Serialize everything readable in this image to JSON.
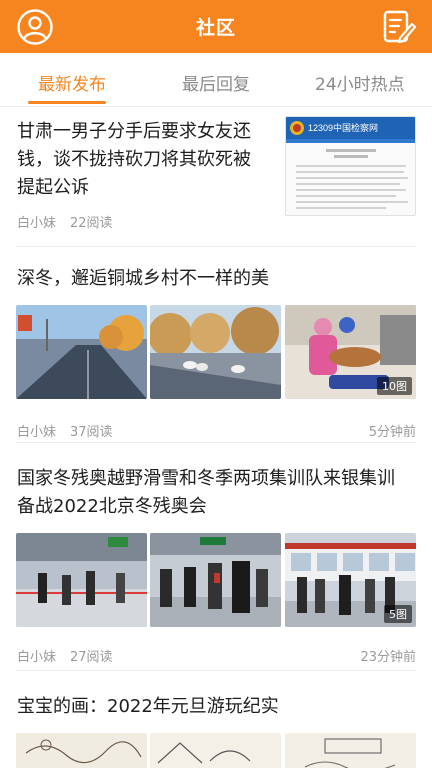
{
  "header": {
    "title": "社区"
  },
  "tabs": [
    {
      "label": "最新发布",
      "active": true
    },
    {
      "label": "最后回复",
      "active": false
    },
    {
      "label": "24小时热点",
      "active": false
    }
  ],
  "articles": [
    {
      "title_lines": [
        "甘肃一男子分手后要求女友还",
        "钱，谈不拢持砍刀将其砍死被",
        "提起公诉"
      ],
      "author": "白小妹",
      "reads": "22阅读",
      "time": "",
      "thumb": {
        "site_name": "12309中国检察网"
      }
    },
    {
      "title_lines": [
        "深冬，邂逅铜城乡村不一样的美"
      ],
      "author": "白小妹",
      "reads": "37阅读",
      "time": "5分钟前",
      "image_count": "10图"
    },
    {
      "title_lines": [
        "国家冬残奥越野滑雪和冬季两项集训队来银集训",
        "备战2022北京冬残奥会"
      ],
      "author": "白小妹",
      "reads": "27阅读",
      "time": "23分钟前",
      "image_count": "5图"
    },
    {
      "title_lines": [
        "宝宝的画：2022年元旦游玩纪实"
      ]
    }
  ],
  "colors": {
    "accent": "#f7851f",
    "text": "#1e1e1e",
    "meta": "#9a9a9a"
  },
  "icons": {
    "left": "user-avatar-icon",
    "right": "edit-note-icon"
  }
}
